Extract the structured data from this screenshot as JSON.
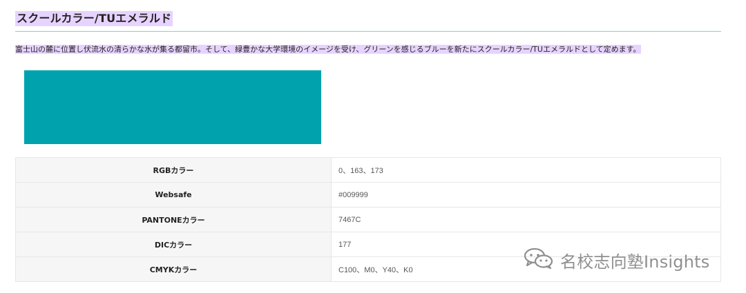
{
  "section": {
    "title": "スクールカラー/TUエメラルド",
    "description": "富士山の麓に位置し伏流水の清らかな水が集る都留市。そして、緑豊かな大学環境のイメージを受け、グリーンを感じるブルーを新たにスクールカラー/TUエメラルドとして定めます。"
  },
  "swatch": {
    "color": "#00a3ad"
  },
  "colors": {
    "highlight": "#e7d3ff",
    "heading_rule": "#7fd3c9"
  },
  "spec_table": {
    "rows": [
      {
        "label": "RGBカラー",
        "value": "0、163、173"
      },
      {
        "label": "Websafe",
        "value": "#009999"
      },
      {
        "label": "PANTONEカラー",
        "value": "7467C"
      },
      {
        "label": "DICカラー",
        "value": "177"
      },
      {
        "label": "CMYKカラー",
        "value": "C100、M0、Y40、K0"
      }
    ]
  },
  "watermark": {
    "icon": "wechat-icon",
    "text": "名校志向塾Insights"
  }
}
